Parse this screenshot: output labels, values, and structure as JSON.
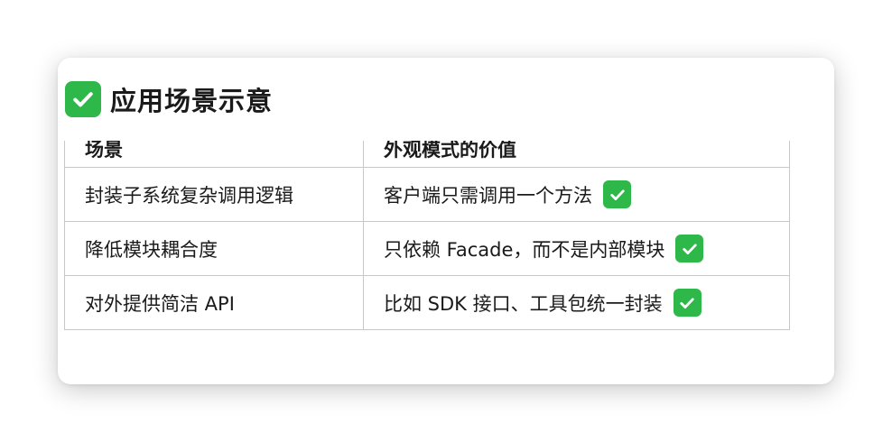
{
  "heading": {
    "icon": "check-mark-icon",
    "title": "应用场景示意"
  },
  "table": {
    "headers": [
      "场景",
      "外观模式的价值"
    ],
    "rows": [
      {
        "scene": "封装子系统复杂调用逻辑",
        "value": "客户端只需调用一个方法",
        "icon": "check-mark-icon"
      },
      {
        "scene": "降低模块耦合度",
        "value": "只依赖 Facade，而不是内部模块",
        "icon": "check-mark-icon"
      },
      {
        "scene": "对外提供简洁 API",
        "value": "比如 SDK 接口、工具包统一封装",
        "icon": "check-mark-icon"
      }
    ]
  },
  "colors": {
    "check_green": "#2fb84a",
    "border": "#c8c8c8"
  }
}
